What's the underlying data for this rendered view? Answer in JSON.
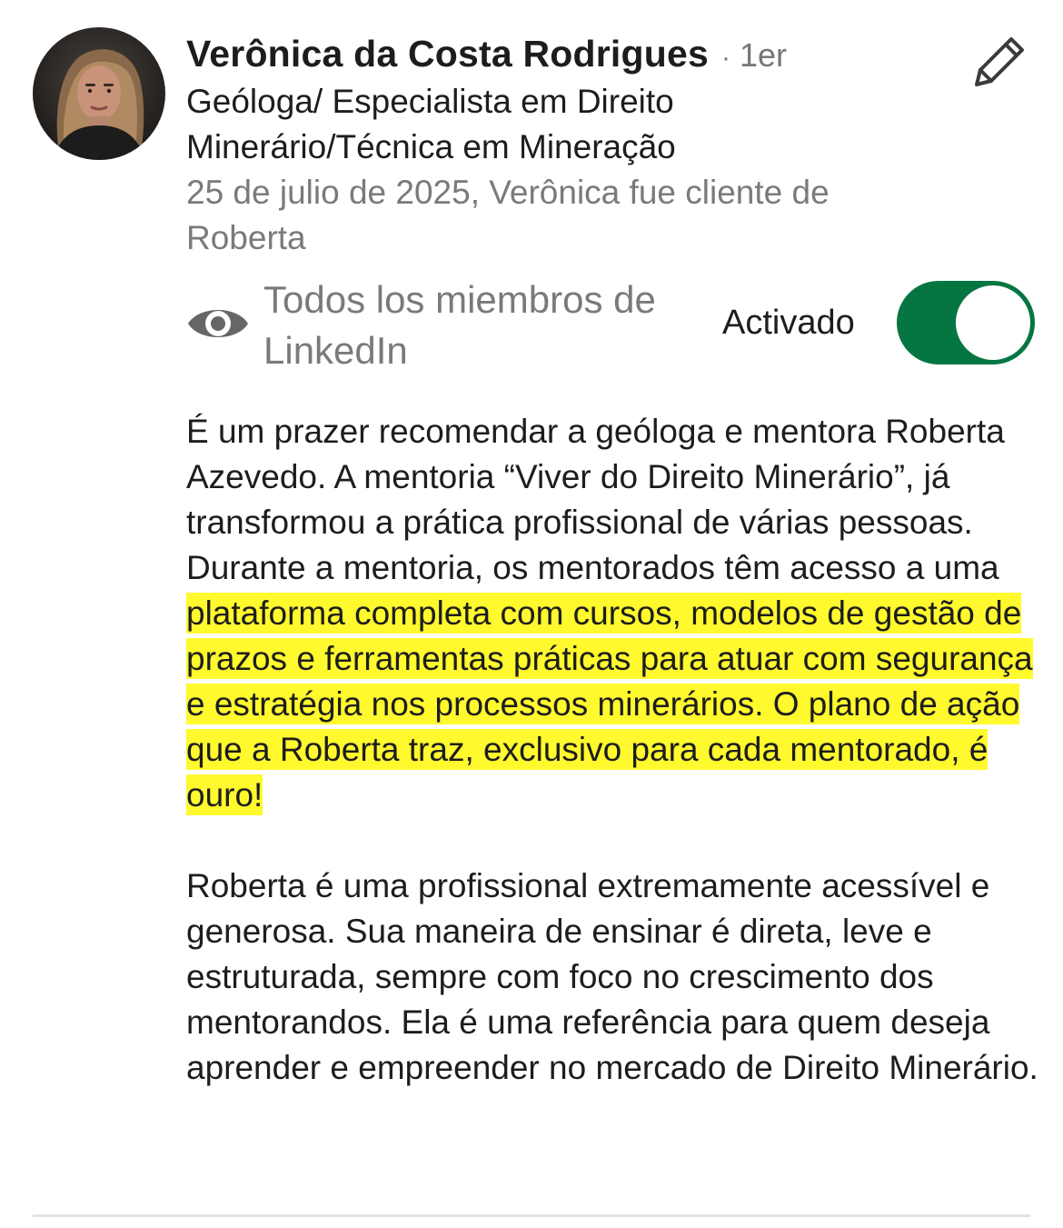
{
  "recommendation": {
    "name": "Verônica da Costa Rodrigues",
    "separator": "·",
    "degree": "1er",
    "headline": "Geóloga/ Especialista em Direito Minerário/Técnica em Mineração",
    "meta": "25 de julio de 2025, Verônica fue cliente de Roberta",
    "avatar_icon": "profile-photo",
    "edit_icon": "pencil-icon"
  },
  "visibility": {
    "icon": "eye-icon",
    "label": "Todos los miembros de LinkedIn",
    "status_label": "Activado",
    "toggle_on": true,
    "toggle_color": "#057642"
  },
  "text": {
    "p1_before": "É um prazer recomendar a geóloga e mentora Roberta Azevedo. A mentoria “Viver do Direito Minerário”, já transformou a prática profissional de várias pessoas. Durante a mentoria, os mentorados têm acesso a uma ",
    "p1_highlight": "plataforma completa com cursos, modelos de gestão de prazos e ferramentas práticas para atuar com segurança e estratégia nos processos minerários. O plano de ação que a Roberta traz, exclusivo para cada mentorado, é ouro!",
    "p2": "Roberta é uma profissional extremamente acessível e generosa. Sua maneira de ensinar é direta, leve e estruturada, sempre com foco no crescimento dos mentorandos. Ela é uma referência para quem deseja aprender e empreender no mercado de Direito Minerário.",
    "highlight_color": "#fff800"
  }
}
